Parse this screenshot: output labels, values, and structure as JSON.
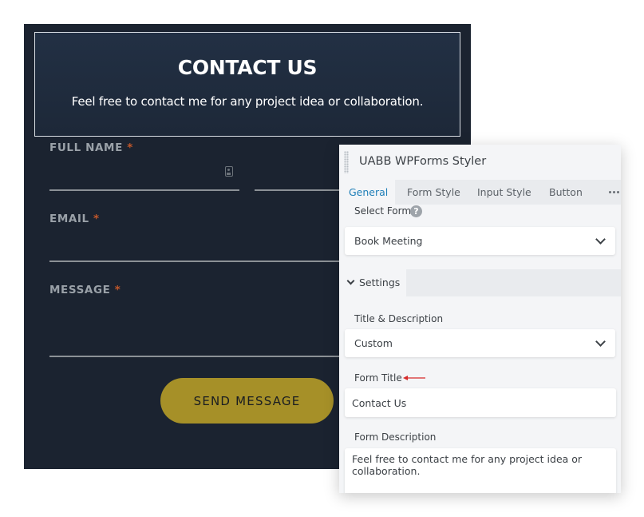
{
  "contact_form": {
    "title": "CONTACT US",
    "description": "Feel free to contact me for any project idea or collaboration.",
    "fields": [
      {
        "label": "FULL NAME",
        "required_mark": "*"
      },
      {
        "label": "EMAIL",
        "required_mark": "*"
      },
      {
        "label": "MESSAGE",
        "required_mark": "*"
      }
    ],
    "submit_label": "SEND MESSAGE",
    "colors": {
      "background": "#1b2330",
      "button": "#a69028",
      "required": "#c2572a"
    }
  },
  "settings_panel": {
    "title": "UABB WPForms Styler",
    "tabs": [
      "General",
      "Form Style",
      "Input Style",
      "Button"
    ],
    "active_tab": "General",
    "more_icon": "ellipsis-icon",
    "select_form": {
      "label": "Select Form",
      "help_icon": "question-icon",
      "value": "Book Meeting"
    },
    "section": {
      "label": "Settings",
      "icon": "chevron-down-icon"
    },
    "title_description": {
      "label": "Title & Description",
      "value": "Custom"
    },
    "form_title": {
      "label": "Form Title",
      "value": "Contact Us"
    },
    "form_description": {
      "label": "Form Description",
      "value": "Feel free to contact me for any project idea or collaboration."
    },
    "accent_color": "#1f7fb8"
  }
}
